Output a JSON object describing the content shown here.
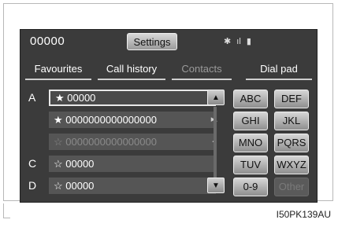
{
  "topbar": {
    "code": "00000",
    "settings_label": "Settings",
    "signal": "ıl",
    "battery": "▮"
  },
  "tabs": [
    {
      "label": "Favourites",
      "active": true
    },
    {
      "label": "Call history",
      "active": false
    },
    {
      "label": "Contacts",
      "active": false
    },
    {
      "label": "Dial pad",
      "active": false
    }
  ],
  "contacts": [
    {
      "letter": "A",
      "name": "★ 00000",
      "state": "selected"
    },
    {
      "letter": "",
      "name": "★ 0000000000000000",
      "state": "normal"
    },
    {
      "letter": "",
      "name": "☆ 0000000000000000",
      "state": "faded"
    },
    {
      "letter": "C",
      "name": "☆ 00000",
      "state": "normal"
    },
    {
      "letter": "D",
      "name": "☆ 00000",
      "state": "normal"
    }
  ],
  "side_icons": {
    "row2": "▸.",
    "row3": "◂"
  },
  "scroll": {
    "up_icon": "▲",
    "down_icon": "▼"
  },
  "keypad": [
    {
      "label": "ABC",
      "enabled": true
    },
    {
      "label": "DEF",
      "enabled": true
    },
    {
      "label": "GHI",
      "enabled": true
    },
    {
      "label": "JKL",
      "enabled": true
    },
    {
      "label": "MNO",
      "enabled": true
    },
    {
      "label": "PQRS",
      "enabled": true
    },
    {
      "label": "TUV",
      "enabled": true
    },
    {
      "label": "WXYZ",
      "enabled": true
    },
    {
      "label": "0-9",
      "enabled": true
    },
    {
      "label": "Other",
      "enabled": false
    }
  ],
  "caption": "I50PK139AU"
}
